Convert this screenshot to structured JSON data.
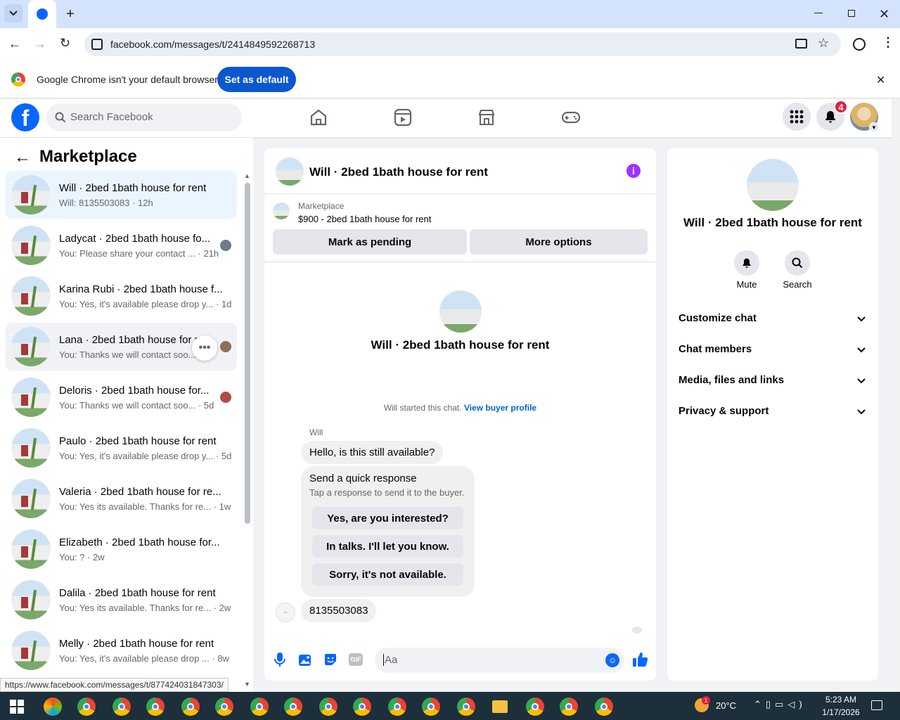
{
  "browser": {
    "url": "facebook.com/messages/t/2414849592268713",
    "infobar_text": "Google Chrome isn't your default browser",
    "set_default_label": "Set as default",
    "status_url": "https://www.facebook.com/messages/t/877424031847303/"
  },
  "fb": {
    "search_placeholder": "Search Facebook",
    "notification_count": "4",
    "brand_color": "#0866ff"
  },
  "left": {
    "title": "Marketplace",
    "conversations": [
      {
        "title": "Will · 2bed 1bath house for rent",
        "snippet": "Will: 8135503083 · 12h"
      },
      {
        "title": "Ladycat · 2bed 1bath house fo...",
        "snippet": "You: Please share your contact ... · 21h"
      },
      {
        "title": "Karina Rubi · 2bed 1bath house f...",
        "snippet": "You: Yes, it's available please drop y... · 1d"
      },
      {
        "title": "Lana · 2bed 1bath house for r",
        "snippet": "You: Thanks we will contact soo..."
      },
      {
        "title": "Deloris · 2bed 1bath house for...",
        "snippet": "You: Thanks we will contact soo... · 5d"
      },
      {
        "title": "Paulo · 2bed 1bath house for rent",
        "snippet": "You: Yes, it's available please drop y... · 5d"
      },
      {
        "title": "Valeria · 2bed 1bath house for re...",
        "snippet": "You: Yes its available. Thanks for re... · 1w"
      },
      {
        "title": "Elizabeth · 2bed 1bath house for...",
        "snippet": "You: ? · 2w"
      },
      {
        "title": "Dalila · 2bed 1bath house for rent",
        "snippet": "You: Yes its available. Thanks for re... · 2w"
      },
      {
        "title": "Melly · 2bed 1bath house for rent",
        "snippet": "You: Yes, it's available please drop ... · 8w"
      }
    ]
  },
  "chat": {
    "header_title": "Will · 2bed 1bath house for rent",
    "listing_source": "Marketplace",
    "listing_desc": "$900 - 2bed 1bath house for rent",
    "mark_pending": "Mark as pending",
    "more_options": "More options",
    "profile_name": "Will · 2bed 1bath house for rent",
    "started_text": "Will started this chat.",
    "view_buyer": "View buyer profile",
    "sender_name": "Will",
    "msg1": "Hello, is this still available?",
    "quick_title": "Send a quick response",
    "quick_sub": "Tap a response to send it to the buyer.",
    "quick_responses": [
      "Yes, are you interested?",
      "In talks. I'll let you know.",
      "Sorry, it's not available."
    ],
    "msg2": "8135503083",
    "composer_placeholder": "Aa"
  },
  "info": {
    "name": "Will · 2bed 1bath house for rent",
    "mute": "Mute",
    "search": "Search",
    "sections": [
      "Customize chat",
      "Chat members",
      "Media, files and links",
      "Privacy & support"
    ]
  },
  "taskbar": {
    "temp": "20°C",
    "time": "5:23 AM",
    "date": "1/17/2026"
  }
}
